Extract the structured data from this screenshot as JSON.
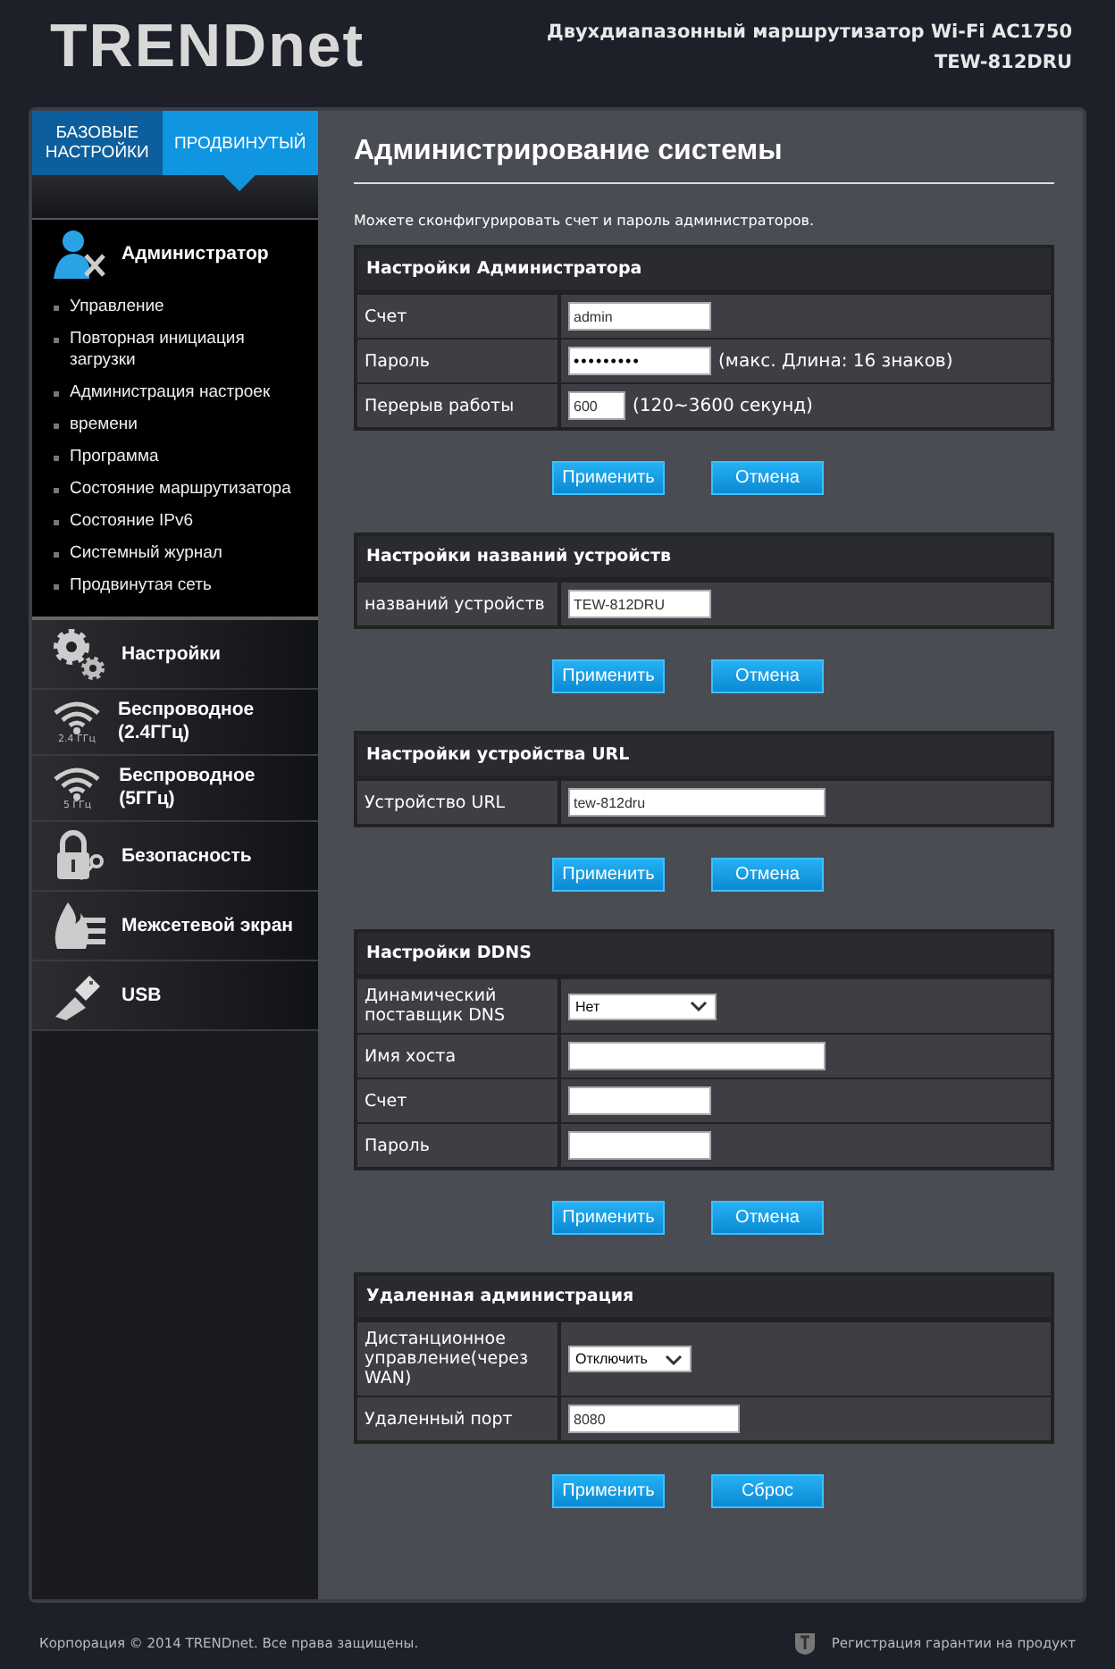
{
  "header": {
    "logo": "TRENDnet",
    "product": "Двухдиапазонный маршрутизатор Wi-Fi AC1750",
    "model": "TEW-812DRU"
  },
  "sidebar": {
    "tabs": [
      {
        "label": "БАЗОВЫЕ НАСТРОЙКИ",
        "selected": false
      },
      {
        "label": "ПРОДВИНУТЫЙ",
        "selected": true
      }
    ],
    "categories": [
      {
        "label": "Администратор",
        "expanded": true,
        "children": [
          {
            "label": "Управление"
          },
          {
            "label": "Повторная инициация загрузки"
          },
          {
            "label": "Администрация настроек"
          },
          {
            "label": "времени"
          },
          {
            "label": "Программа"
          },
          {
            "label": "Состояние маршрутизатора"
          },
          {
            "label": "Состояние IPv6"
          },
          {
            "label": "Системный журнал"
          },
          {
            "label": "Продвинутая сеть"
          }
        ]
      },
      {
        "label": "Настройки",
        "expanded": false
      },
      {
        "label": "Беспроводное (2.4ГГц)",
        "icon_label": "2.4 ГГц",
        "expanded": false
      },
      {
        "label": "Беспроводное (5ГГц)",
        "icon_label": "5 ГГц",
        "expanded": false
      },
      {
        "label": "Безопасность",
        "expanded": false
      },
      {
        "label": "Межсетевой экран",
        "expanded": false
      },
      {
        "label": "USB",
        "expanded": false
      }
    ]
  },
  "main": {
    "title": "Администрирование системы",
    "description": "Можете сконфигурировать счет и пароль администраторов.",
    "sections": [
      {
        "title": "Настройки Администратора",
        "rows": [
          {
            "label": "Счет",
            "field": {
              "kind": "text",
              "value": "admin"
            }
          },
          {
            "label": "Пароль",
            "field": {
              "kind": "password",
              "value": "•••••••••"
            },
            "note": "(макс. Длина: 16 знаков)"
          },
          {
            "label": "Перерыв работы",
            "field": {
              "kind": "number",
              "value": "600"
            },
            "note": "(120~3600 секунд)"
          }
        ],
        "buttons": [
          "Применить",
          "Отмена"
        ]
      },
      {
        "title": "Настройки названий устройств",
        "rows": [
          {
            "label": "названий устройств",
            "field": {
              "kind": "text",
              "value": "TEW-812DRU"
            }
          }
        ],
        "buttons": [
          "Применить",
          "Отмена"
        ]
      },
      {
        "title": "Настройки устройства URL",
        "rows": [
          {
            "label": "Устройство URL",
            "field": {
              "kind": "wide",
              "value": "tew-812dru"
            }
          }
        ],
        "buttons": [
          "Применить",
          "Отмена"
        ]
      },
      {
        "title": "Настройки DDNS",
        "rows": [
          {
            "label": "Динамический поставщик DNS",
            "field": {
              "kind": "select",
              "value": "Нет"
            }
          },
          {
            "label": "Имя хоста",
            "field": {
              "kind": "wide"
            }
          },
          {
            "label": "Счет",
            "field": {
              "kind": "text"
            }
          },
          {
            "label": "Пароль",
            "field": {
              "kind": "text"
            }
          }
        ],
        "buttons": [
          "Применить",
          "Отмена"
        ]
      },
      {
        "title": "Удаленная администрация",
        "rows": [
          {
            "label": "Дистанционное управление(через WAN)",
            "field": {
              "kind": "select-small",
              "value": "Отключить"
            }
          },
          {
            "label": "Удаленный порт",
            "field": {
              "kind": "wide-short",
              "value": "8080"
            }
          }
        ],
        "buttons": [
          "Применить",
          "Сброс"
        ]
      }
    ]
  },
  "footer": {
    "copyright": "Корпорация © 2014 TRENDnet. Все права защищены.",
    "warranty": "Регистрация гарантии на продукт"
  }
}
